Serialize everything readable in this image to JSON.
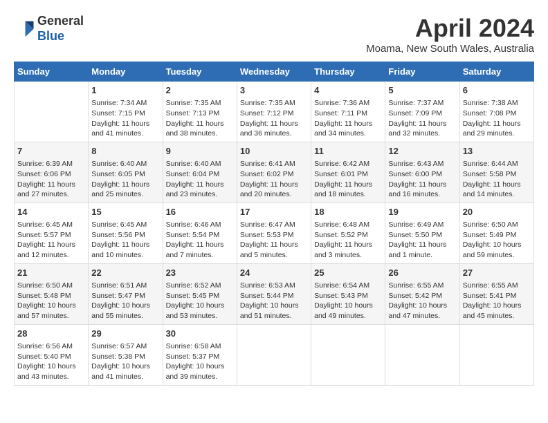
{
  "logo": {
    "line1": "General",
    "line2": "Blue"
  },
  "title": "April 2024",
  "location": "Moama, New South Wales, Australia",
  "days_of_week": [
    "Sunday",
    "Monday",
    "Tuesday",
    "Wednesday",
    "Thursday",
    "Friday",
    "Saturday"
  ],
  "weeks": [
    [
      {
        "day": "",
        "content": ""
      },
      {
        "day": "1",
        "content": "Sunrise: 7:34 AM\nSunset: 7:15 PM\nDaylight: 11 hours\nand 41 minutes."
      },
      {
        "day": "2",
        "content": "Sunrise: 7:35 AM\nSunset: 7:13 PM\nDaylight: 11 hours\nand 38 minutes."
      },
      {
        "day": "3",
        "content": "Sunrise: 7:35 AM\nSunset: 7:12 PM\nDaylight: 11 hours\nand 36 minutes."
      },
      {
        "day": "4",
        "content": "Sunrise: 7:36 AM\nSunset: 7:11 PM\nDaylight: 11 hours\nand 34 minutes."
      },
      {
        "day": "5",
        "content": "Sunrise: 7:37 AM\nSunset: 7:09 PM\nDaylight: 11 hours\nand 32 minutes."
      },
      {
        "day": "6",
        "content": "Sunrise: 7:38 AM\nSunset: 7:08 PM\nDaylight: 11 hours\nand 29 minutes."
      }
    ],
    [
      {
        "day": "7",
        "content": "Sunrise: 6:39 AM\nSunset: 6:06 PM\nDaylight: 11 hours\nand 27 minutes."
      },
      {
        "day": "8",
        "content": "Sunrise: 6:40 AM\nSunset: 6:05 PM\nDaylight: 11 hours\nand 25 minutes."
      },
      {
        "day": "9",
        "content": "Sunrise: 6:40 AM\nSunset: 6:04 PM\nDaylight: 11 hours\nand 23 minutes."
      },
      {
        "day": "10",
        "content": "Sunrise: 6:41 AM\nSunset: 6:02 PM\nDaylight: 11 hours\nand 20 minutes."
      },
      {
        "day": "11",
        "content": "Sunrise: 6:42 AM\nSunset: 6:01 PM\nDaylight: 11 hours\nand 18 minutes."
      },
      {
        "day": "12",
        "content": "Sunrise: 6:43 AM\nSunset: 6:00 PM\nDaylight: 11 hours\nand 16 minutes."
      },
      {
        "day": "13",
        "content": "Sunrise: 6:44 AM\nSunset: 5:58 PM\nDaylight: 11 hours\nand 14 minutes."
      }
    ],
    [
      {
        "day": "14",
        "content": "Sunrise: 6:45 AM\nSunset: 5:57 PM\nDaylight: 11 hours\nand 12 minutes."
      },
      {
        "day": "15",
        "content": "Sunrise: 6:45 AM\nSunset: 5:56 PM\nDaylight: 11 hours\nand 10 minutes."
      },
      {
        "day": "16",
        "content": "Sunrise: 6:46 AM\nSunset: 5:54 PM\nDaylight: 11 hours\nand 7 minutes."
      },
      {
        "day": "17",
        "content": "Sunrise: 6:47 AM\nSunset: 5:53 PM\nDaylight: 11 hours\nand 5 minutes."
      },
      {
        "day": "18",
        "content": "Sunrise: 6:48 AM\nSunset: 5:52 PM\nDaylight: 11 hours\nand 3 minutes."
      },
      {
        "day": "19",
        "content": "Sunrise: 6:49 AM\nSunset: 5:50 PM\nDaylight: 11 hours\nand 1 minute."
      },
      {
        "day": "20",
        "content": "Sunrise: 6:50 AM\nSunset: 5:49 PM\nDaylight: 10 hours\nand 59 minutes."
      }
    ],
    [
      {
        "day": "21",
        "content": "Sunrise: 6:50 AM\nSunset: 5:48 PM\nDaylight: 10 hours\nand 57 minutes."
      },
      {
        "day": "22",
        "content": "Sunrise: 6:51 AM\nSunset: 5:47 PM\nDaylight: 10 hours\nand 55 minutes."
      },
      {
        "day": "23",
        "content": "Sunrise: 6:52 AM\nSunset: 5:45 PM\nDaylight: 10 hours\nand 53 minutes."
      },
      {
        "day": "24",
        "content": "Sunrise: 6:53 AM\nSunset: 5:44 PM\nDaylight: 10 hours\nand 51 minutes."
      },
      {
        "day": "25",
        "content": "Sunrise: 6:54 AM\nSunset: 5:43 PM\nDaylight: 10 hours\nand 49 minutes."
      },
      {
        "day": "26",
        "content": "Sunrise: 6:55 AM\nSunset: 5:42 PM\nDaylight: 10 hours\nand 47 minutes."
      },
      {
        "day": "27",
        "content": "Sunrise: 6:55 AM\nSunset: 5:41 PM\nDaylight: 10 hours\nand 45 minutes."
      }
    ],
    [
      {
        "day": "28",
        "content": "Sunrise: 6:56 AM\nSunset: 5:40 PM\nDaylight: 10 hours\nand 43 minutes."
      },
      {
        "day": "29",
        "content": "Sunrise: 6:57 AM\nSunset: 5:38 PM\nDaylight: 10 hours\nand 41 minutes."
      },
      {
        "day": "30",
        "content": "Sunrise: 6:58 AM\nSunset: 5:37 PM\nDaylight: 10 hours\nand 39 minutes."
      },
      {
        "day": "",
        "content": ""
      },
      {
        "day": "",
        "content": ""
      },
      {
        "day": "",
        "content": ""
      },
      {
        "day": "",
        "content": ""
      }
    ]
  ]
}
